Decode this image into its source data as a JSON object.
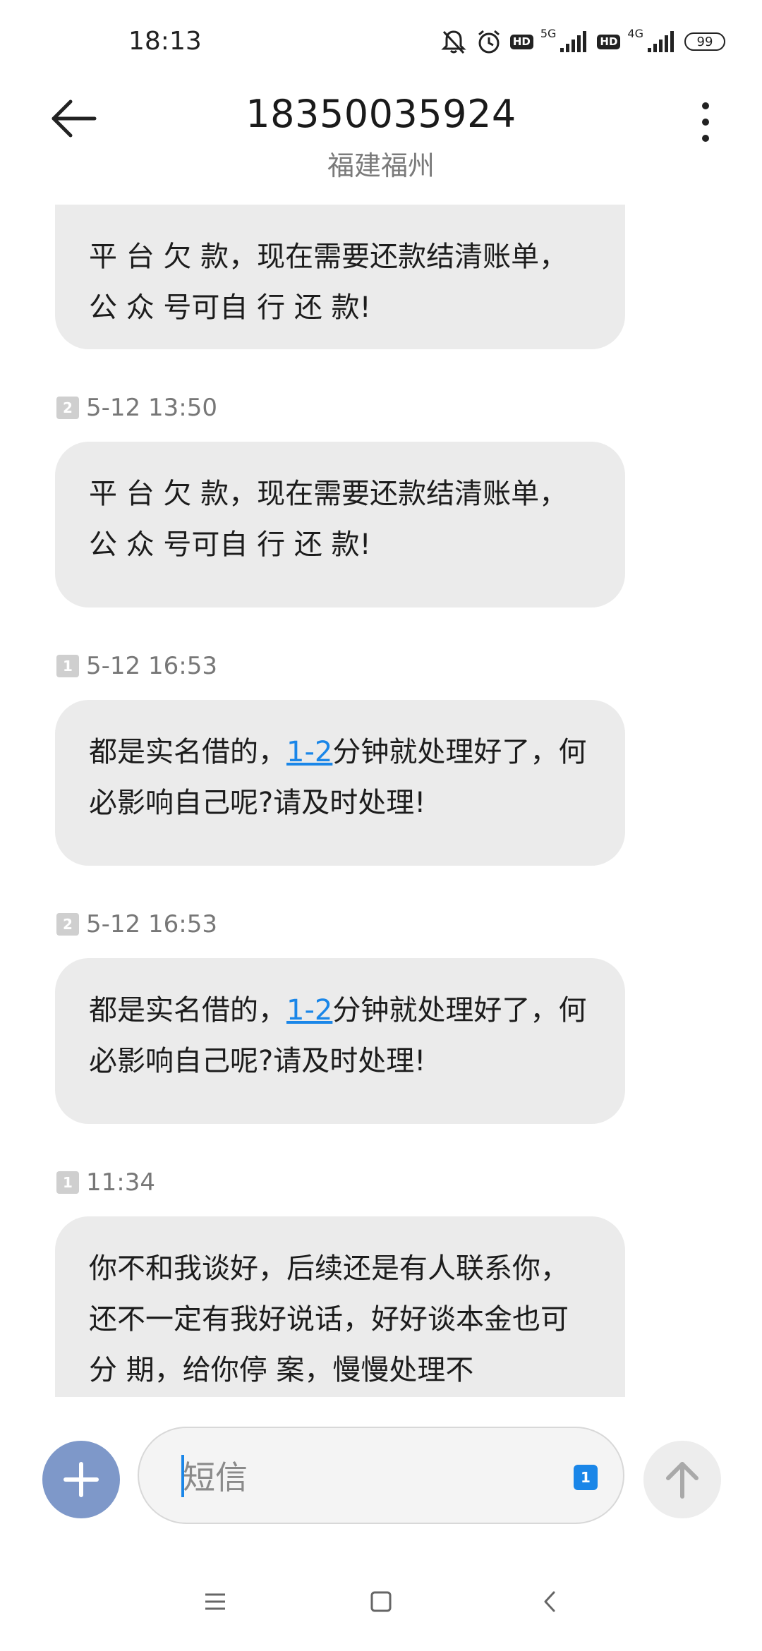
{
  "status_bar": {
    "time": "18:13",
    "hd1": "HD",
    "net1": "5G",
    "hd2": "HD",
    "net2": "4G",
    "battery": "99"
  },
  "header": {
    "title": "18350035924",
    "subtitle": "福建福州"
  },
  "messages": [
    {
      "text": "平 台 欠 款，现在需要还款结清账单，公 众 号可自 行 还 款!"
    },
    {
      "sim": "2",
      "time": "5-12 13:50",
      "text": "平 台 欠 款，现在需要还款结清账单，公 众 号可自 行 还 款!"
    },
    {
      "sim": "1",
      "time": "5-12 16:53",
      "text_before": "都是实名借的，",
      "link": "1-2",
      "text_after": "分钟就处理好了，何必影响自己呢?请及时处理!"
    },
    {
      "sim": "2",
      "time": "5-12 16:53",
      "text_before": "都是实名借的，",
      "link": "1-2",
      "text_after": "分钟就处理好了，何必影响自己呢?请及时处理!"
    },
    {
      "sim": "1",
      "time": "11:34",
      "text": "你不和我谈好，后续还是有人联系你，还不一定有我好说话，好好谈本金也可分 期，给你停 案，慢慢处理不"
    }
  ],
  "composer": {
    "placeholder": "短信",
    "sim": "1"
  },
  "icons": {
    "back": "back-arrow-icon",
    "more": "more-vertical-icon",
    "add": "plus-icon",
    "send": "send-arrow-icon"
  }
}
